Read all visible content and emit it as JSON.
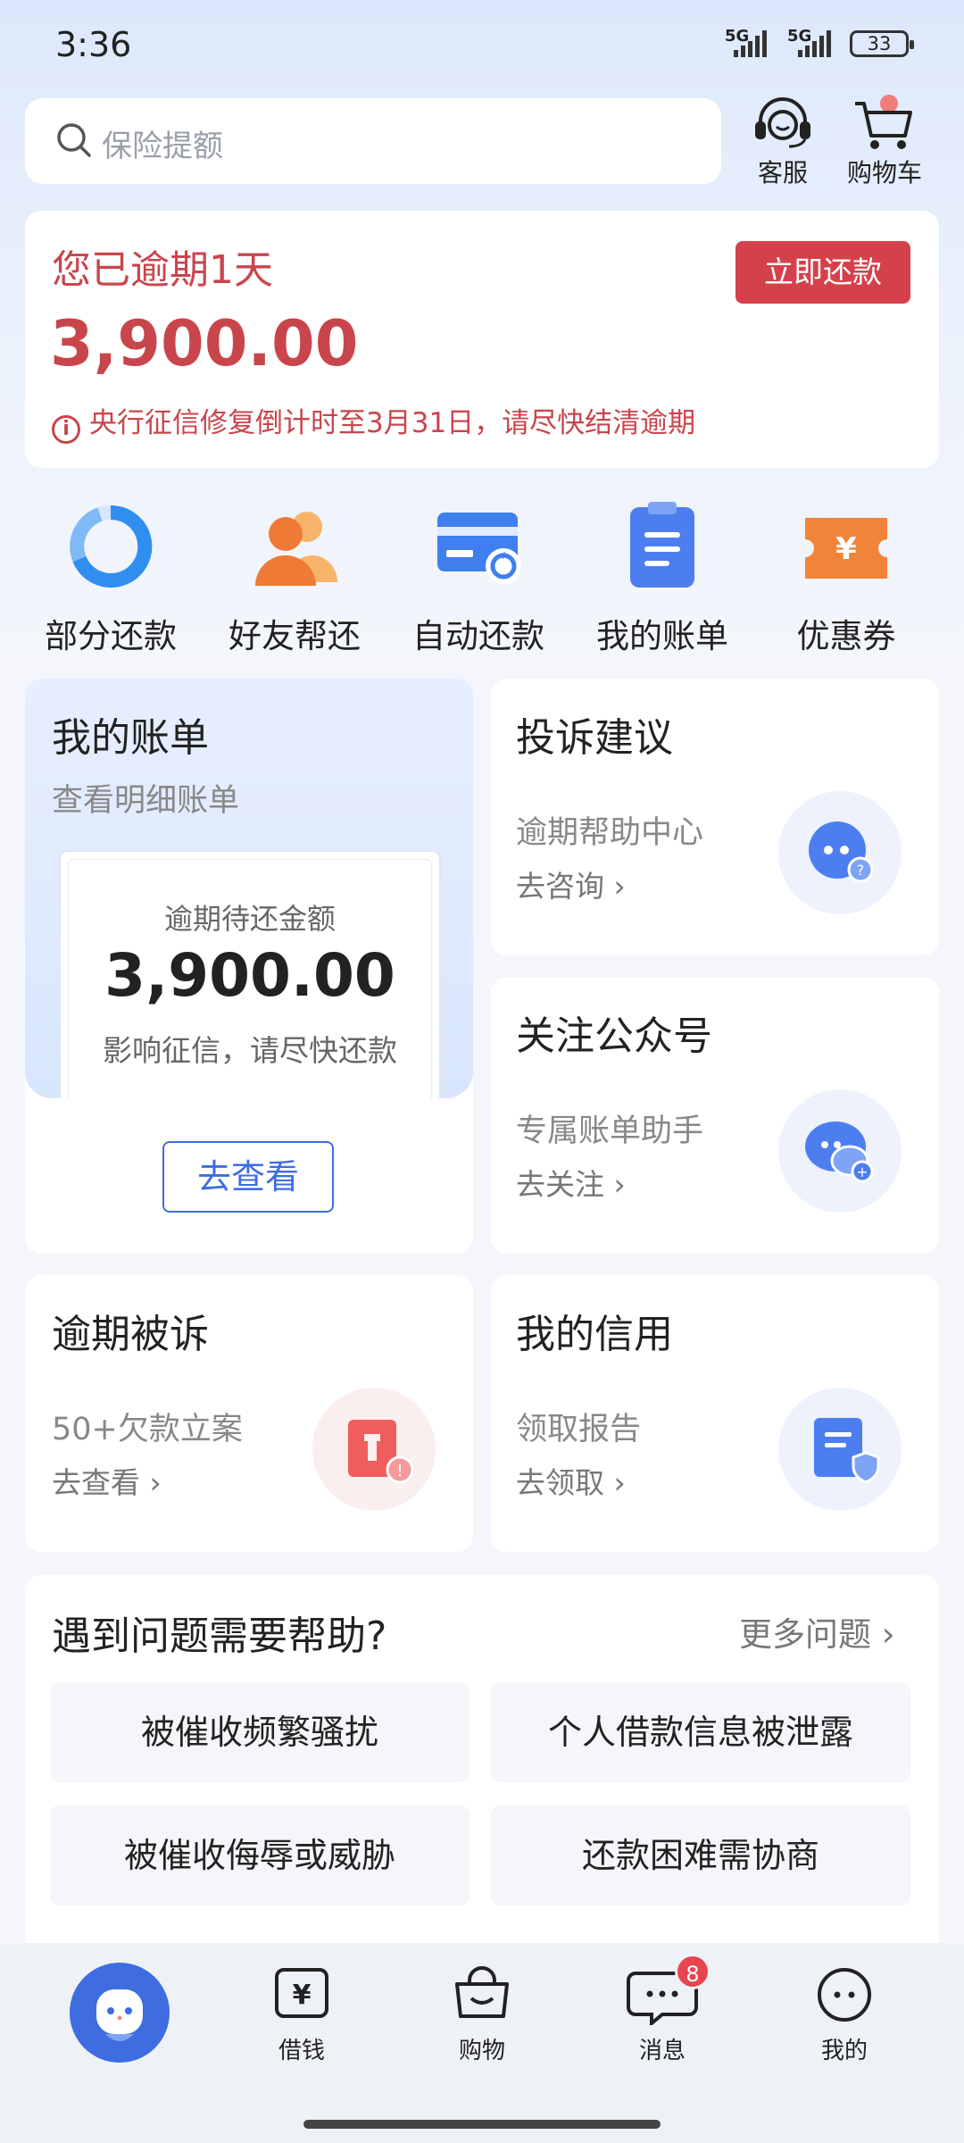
{
  "status_bar": {
    "time": "3:36",
    "signal1": "5G",
    "signal2": "5G",
    "battery": "33"
  },
  "search": {
    "placeholder": "保险提额"
  },
  "header": {
    "service_label": "客服",
    "cart_label": "购物车"
  },
  "overdue": {
    "title": "您已逾期1天",
    "amount": "3,900.00",
    "notice": "央行征信修复倒计时至3月31日，请尽快结清逾期",
    "pay_button": "立即还款"
  },
  "quick_actions": [
    {
      "label": "部分还款",
      "icon": "pie-chart-icon"
    },
    {
      "label": "好友帮还",
      "icon": "friends-icon"
    },
    {
      "label": "自动还款",
      "icon": "card-sync-icon"
    },
    {
      "label": "我的账单",
      "icon": "clipboard-icon"
    },
    {
      "label": "优惠券",
      "icon": "coupon-icon"
    }
  ],
  "bill_card": {
    "title": "我的账单",
    "subtitle": "查看明细账单",
    "ticket_label": "逾期待还金额",
    "ticket_amount": "3,900.00",
    "ticket_note": "影响征信，请尽快还款",
    "button": "去查看"
  },
  "complaint_card": {
    "title": "投诉建议",
    "subtitle": "逾期帮助中心",
    "link": "去咨询"
  },
  "follow_card": {
    "title": "关注公众号",
    "subtitle": "专属账单助手",
    "link": "去关注"
  },
  "lawsuit_card": {
    "title": "逾期被诉",
    "subtitle": "50+欠款立案",
    "link": "去查看"
  },
  "credit_card": {
    "title": "我的信用",
    "subtitle": "领取报告",
    "link": "去领取"
  },
  "help": {
    "title": "遇到问题需要帮助?",
    "more": "更多问题",
    "items": [
      "被催收频繁骚扰",
      "个人借款信息被泄露",
      "被催收侮辱或威胁",
      "还款困难需协商"
    ]
  },
  "tabbar": {
    "tabs": [
      "借钱",
      "购物",
      "消息",
      "我的"
    ],
    "message_badge": "8"
  },
  "colors": {
    "accent_red": "#d5414b",
    "accent_blue": "#3d6de0",
    "orange": "#f08a3c"
  }
}
